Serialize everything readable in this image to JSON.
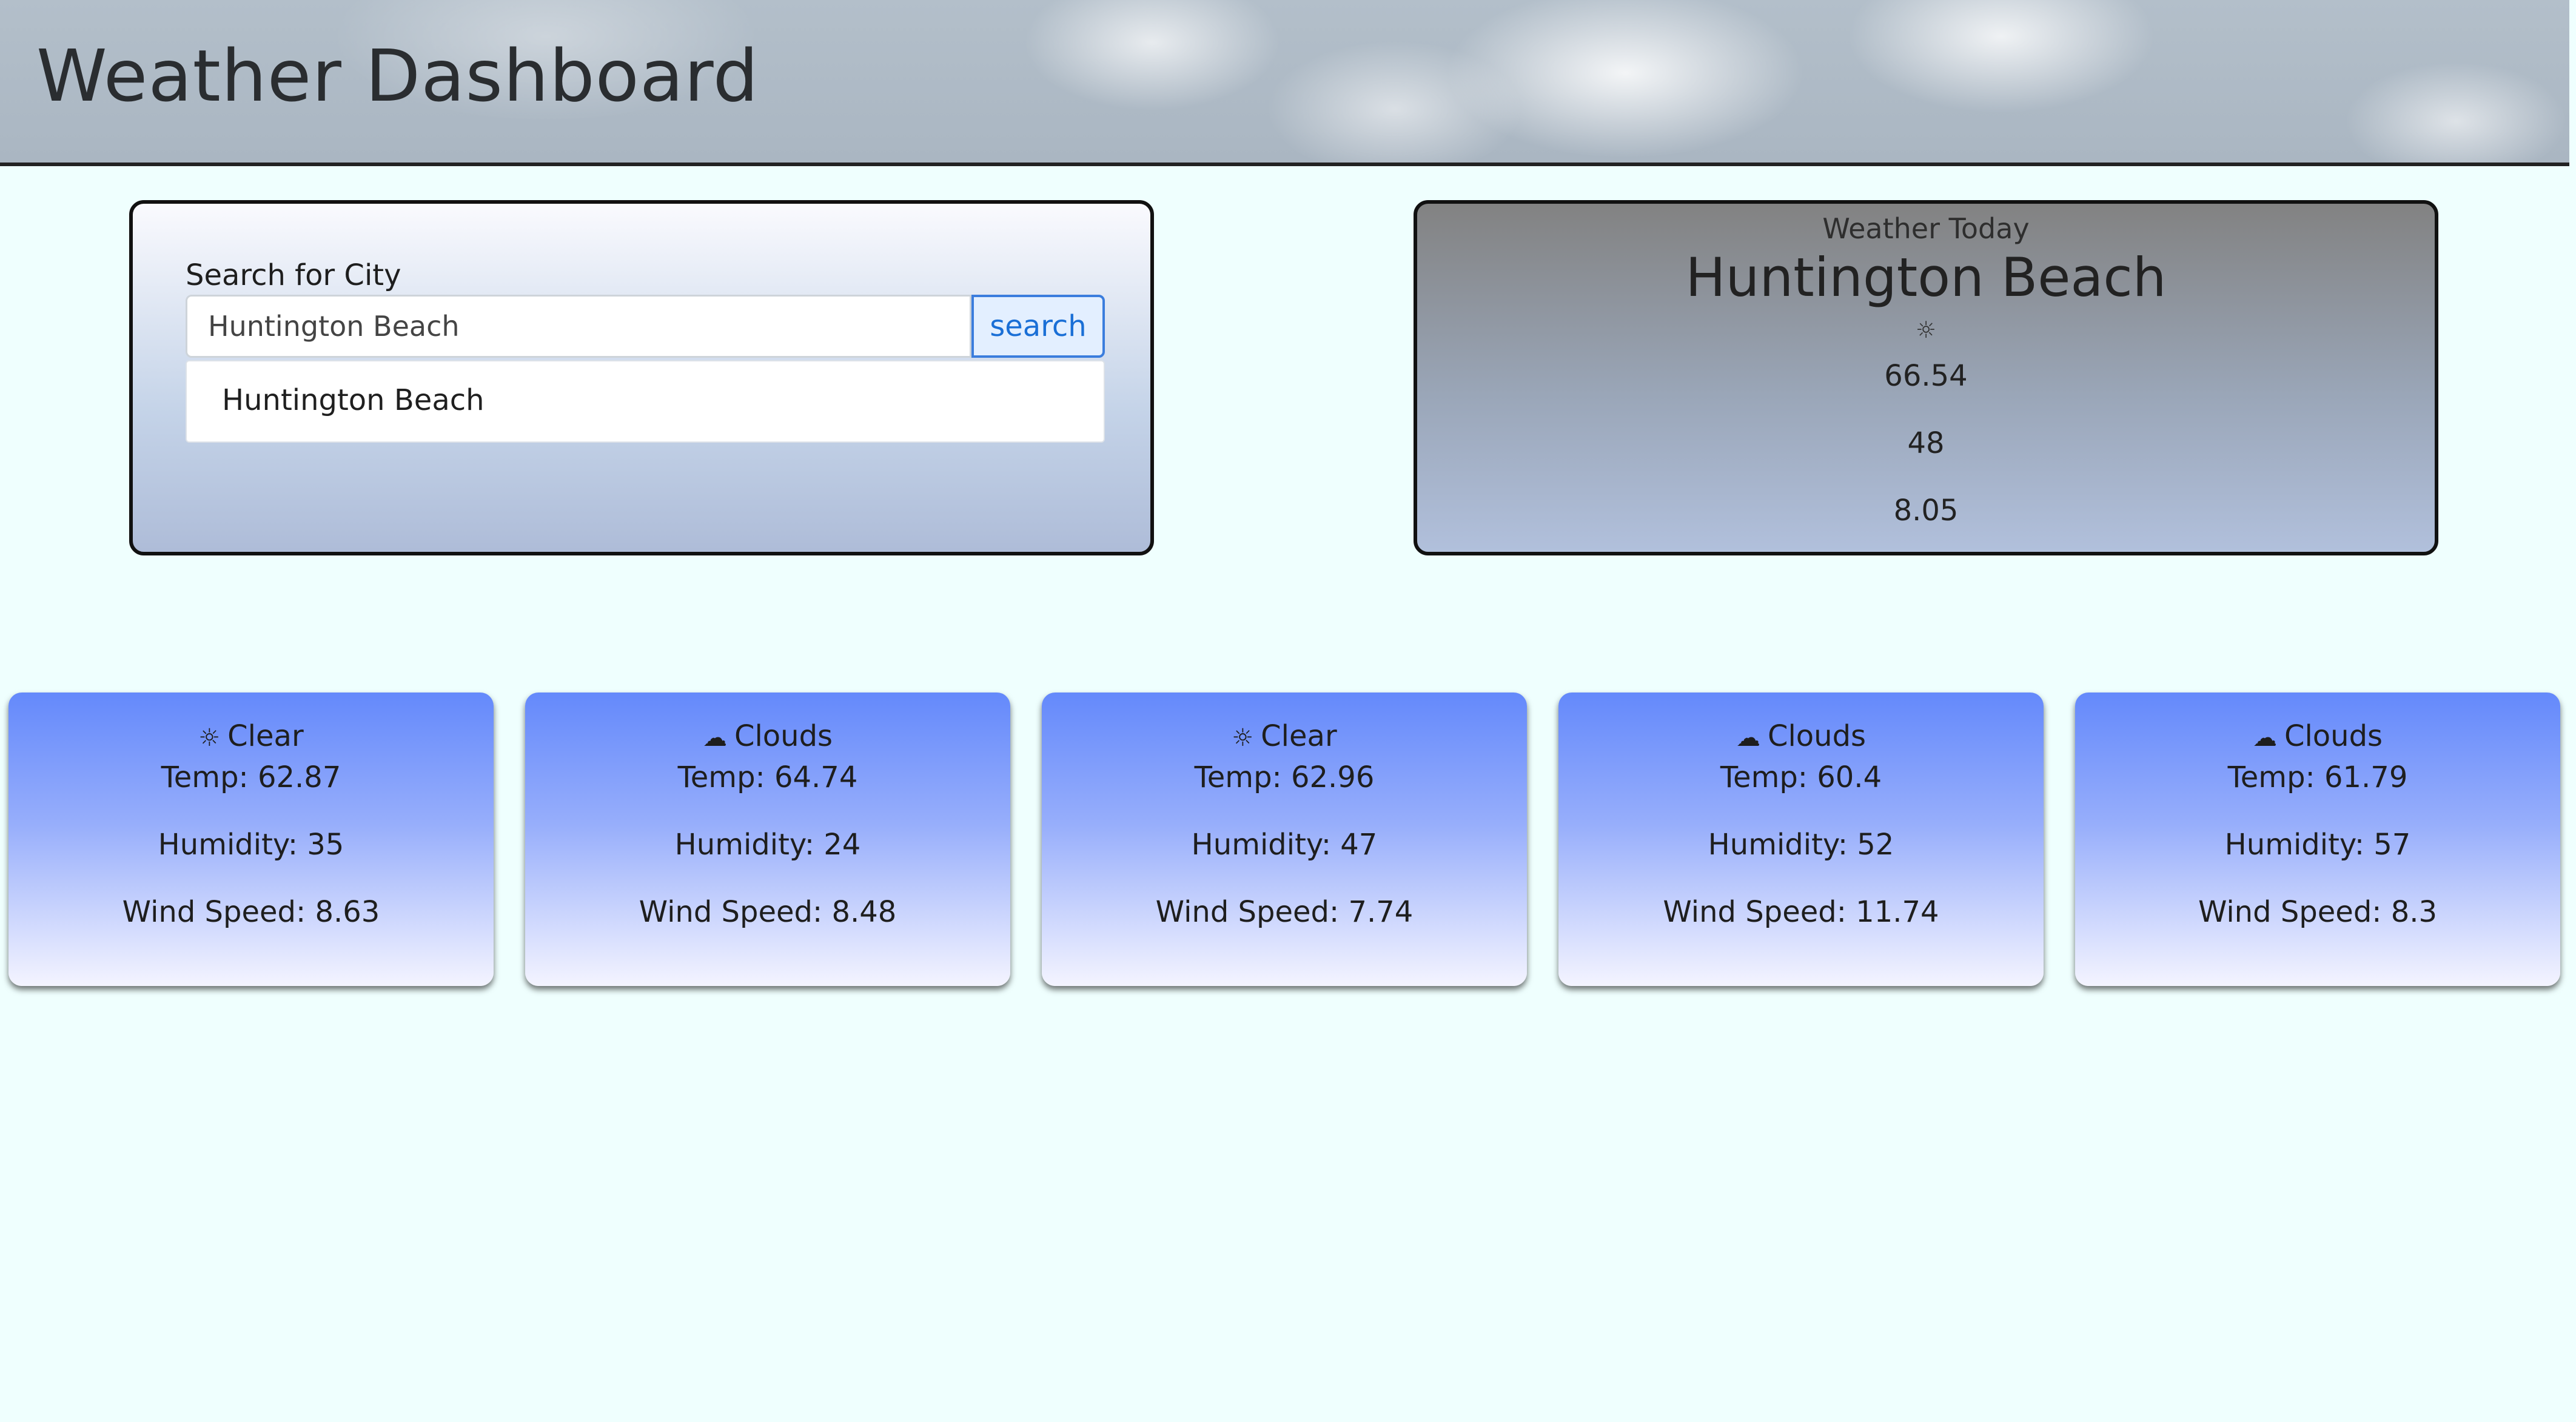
{
  "header": {
    "title": "Weather Dashboard"
  },
  "search": {
    "label": "Search for City",
    "input_value": "Huntington Beach",
    "button_label": "search",
    "suggestions": [
      "Huntington Beach"
    ]
  },
  "today": {
    "heading": "Weather Today",
    "city": "Huntington Beach",
    "icon": "sun-icon",
    "icon_glyph": "☼",
    "temp": "66.54",
    "humidity": "48",
    "wind": "8.05"
  },
  "forecast": [
    {
      "icon": "sun-icon",
      "icon_glyph": "☼",
      "condition": "Clear",
      "temp": "Temp: 62.87",
      "humidity": "Humidity: 35",
      "wind": "Wind Speed: 8.63"
    },
    {
      "icon": "cloud-icon",
      "icon_glyph": "☁",
      "condition": "Clouds",
      "temp": "Temp: 64.74",
      "humidity": "Humidity: 24",
      "wind": "Wind Speed: 8.48"
    },
    {
      "icon": "sun-icon",
      "icon_glyph": "☼",
      "condition": "Clear",
      "temp": "Temp: 62.96",
      "humidity": "Humidity: 47",
      "wind": "Wind Speed: 7.74"
    },
    {
      "icon": "cloud-icon",
      "icon_glyph": "☁",
      "condition": "Clouds",
      "temp": "Temp: 60.4",
      "humidity": "Humidity: 52",
      "wind": "Wind Speed: 11.74"
    },
    {
      "icon": "cloud-icon",
      "icon_glyph": "☁",
      "condition": "Clouds",
      "temp": "Temp: 61.79",
      "humidity": "Humidity: 57",
      "wind": "Wind Speed: 8.3"
    }
  ],
  "colors": {
    "page_background": "#effffe",
    "search_button_accent": "#1a6fd6",
    "card_gradient_top": "#6489fb"
  }
}
